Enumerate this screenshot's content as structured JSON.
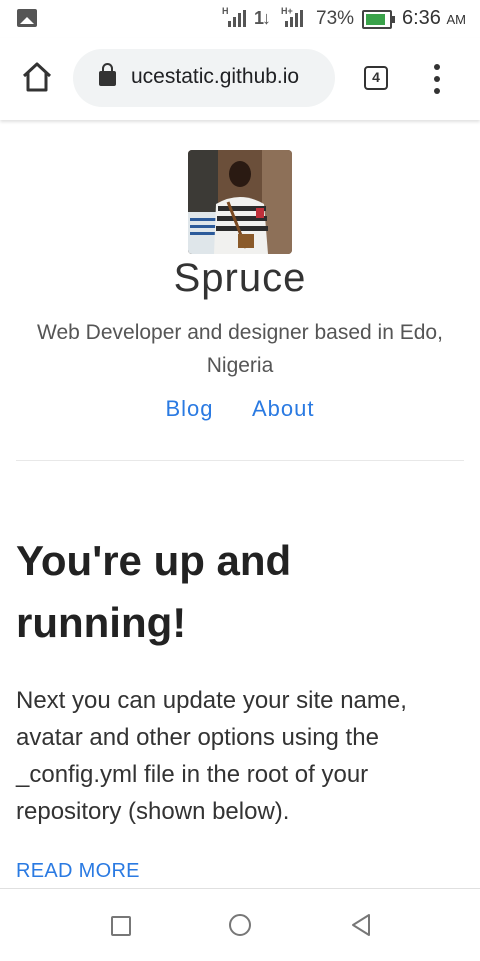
{
  "status_bar": {
    "signal_labels": [
      "H",
      "H+"
    ],
    "data_indicator": "1↓",
    "battery_percent": "73%",
    "battery_level": 0.73,
    "time": "6:36",
    "time_suffix": "AM"
  },
  "browser": {
    "url": "ucestatic.github.io",
    "tab_count": "4"
  },
  "site": {
    "title": "Spruce",
    "description": "Web Developer and designer based in Edo, Nigeria",
    "nav": [
      {
        "label": "Blog"
      },
      {
        "label": "About"
      }
    ]
  },
  "post": {
    "title": "You're up and running!",
    "excerpt": "Next you can update your site name, avatar and other options using the _config.yml file in the root of your repository (shown below).",
    "read_more": "READ MORE"
  },
  "colors": {
    "link": "#2a7ae2",
    "battery": "#3aa24a"
  },
  "icons": {
    "home": "home-icon",
    "lock": "lock-icon",
    "tabs": "tab-switcher-icon",
    "menu": "overflow-menu-icon",
    "recents": "recents-square-icon",
    "nav_home": "home-circle-icon",
    "back": "back-triangle-icon"
  }
}
